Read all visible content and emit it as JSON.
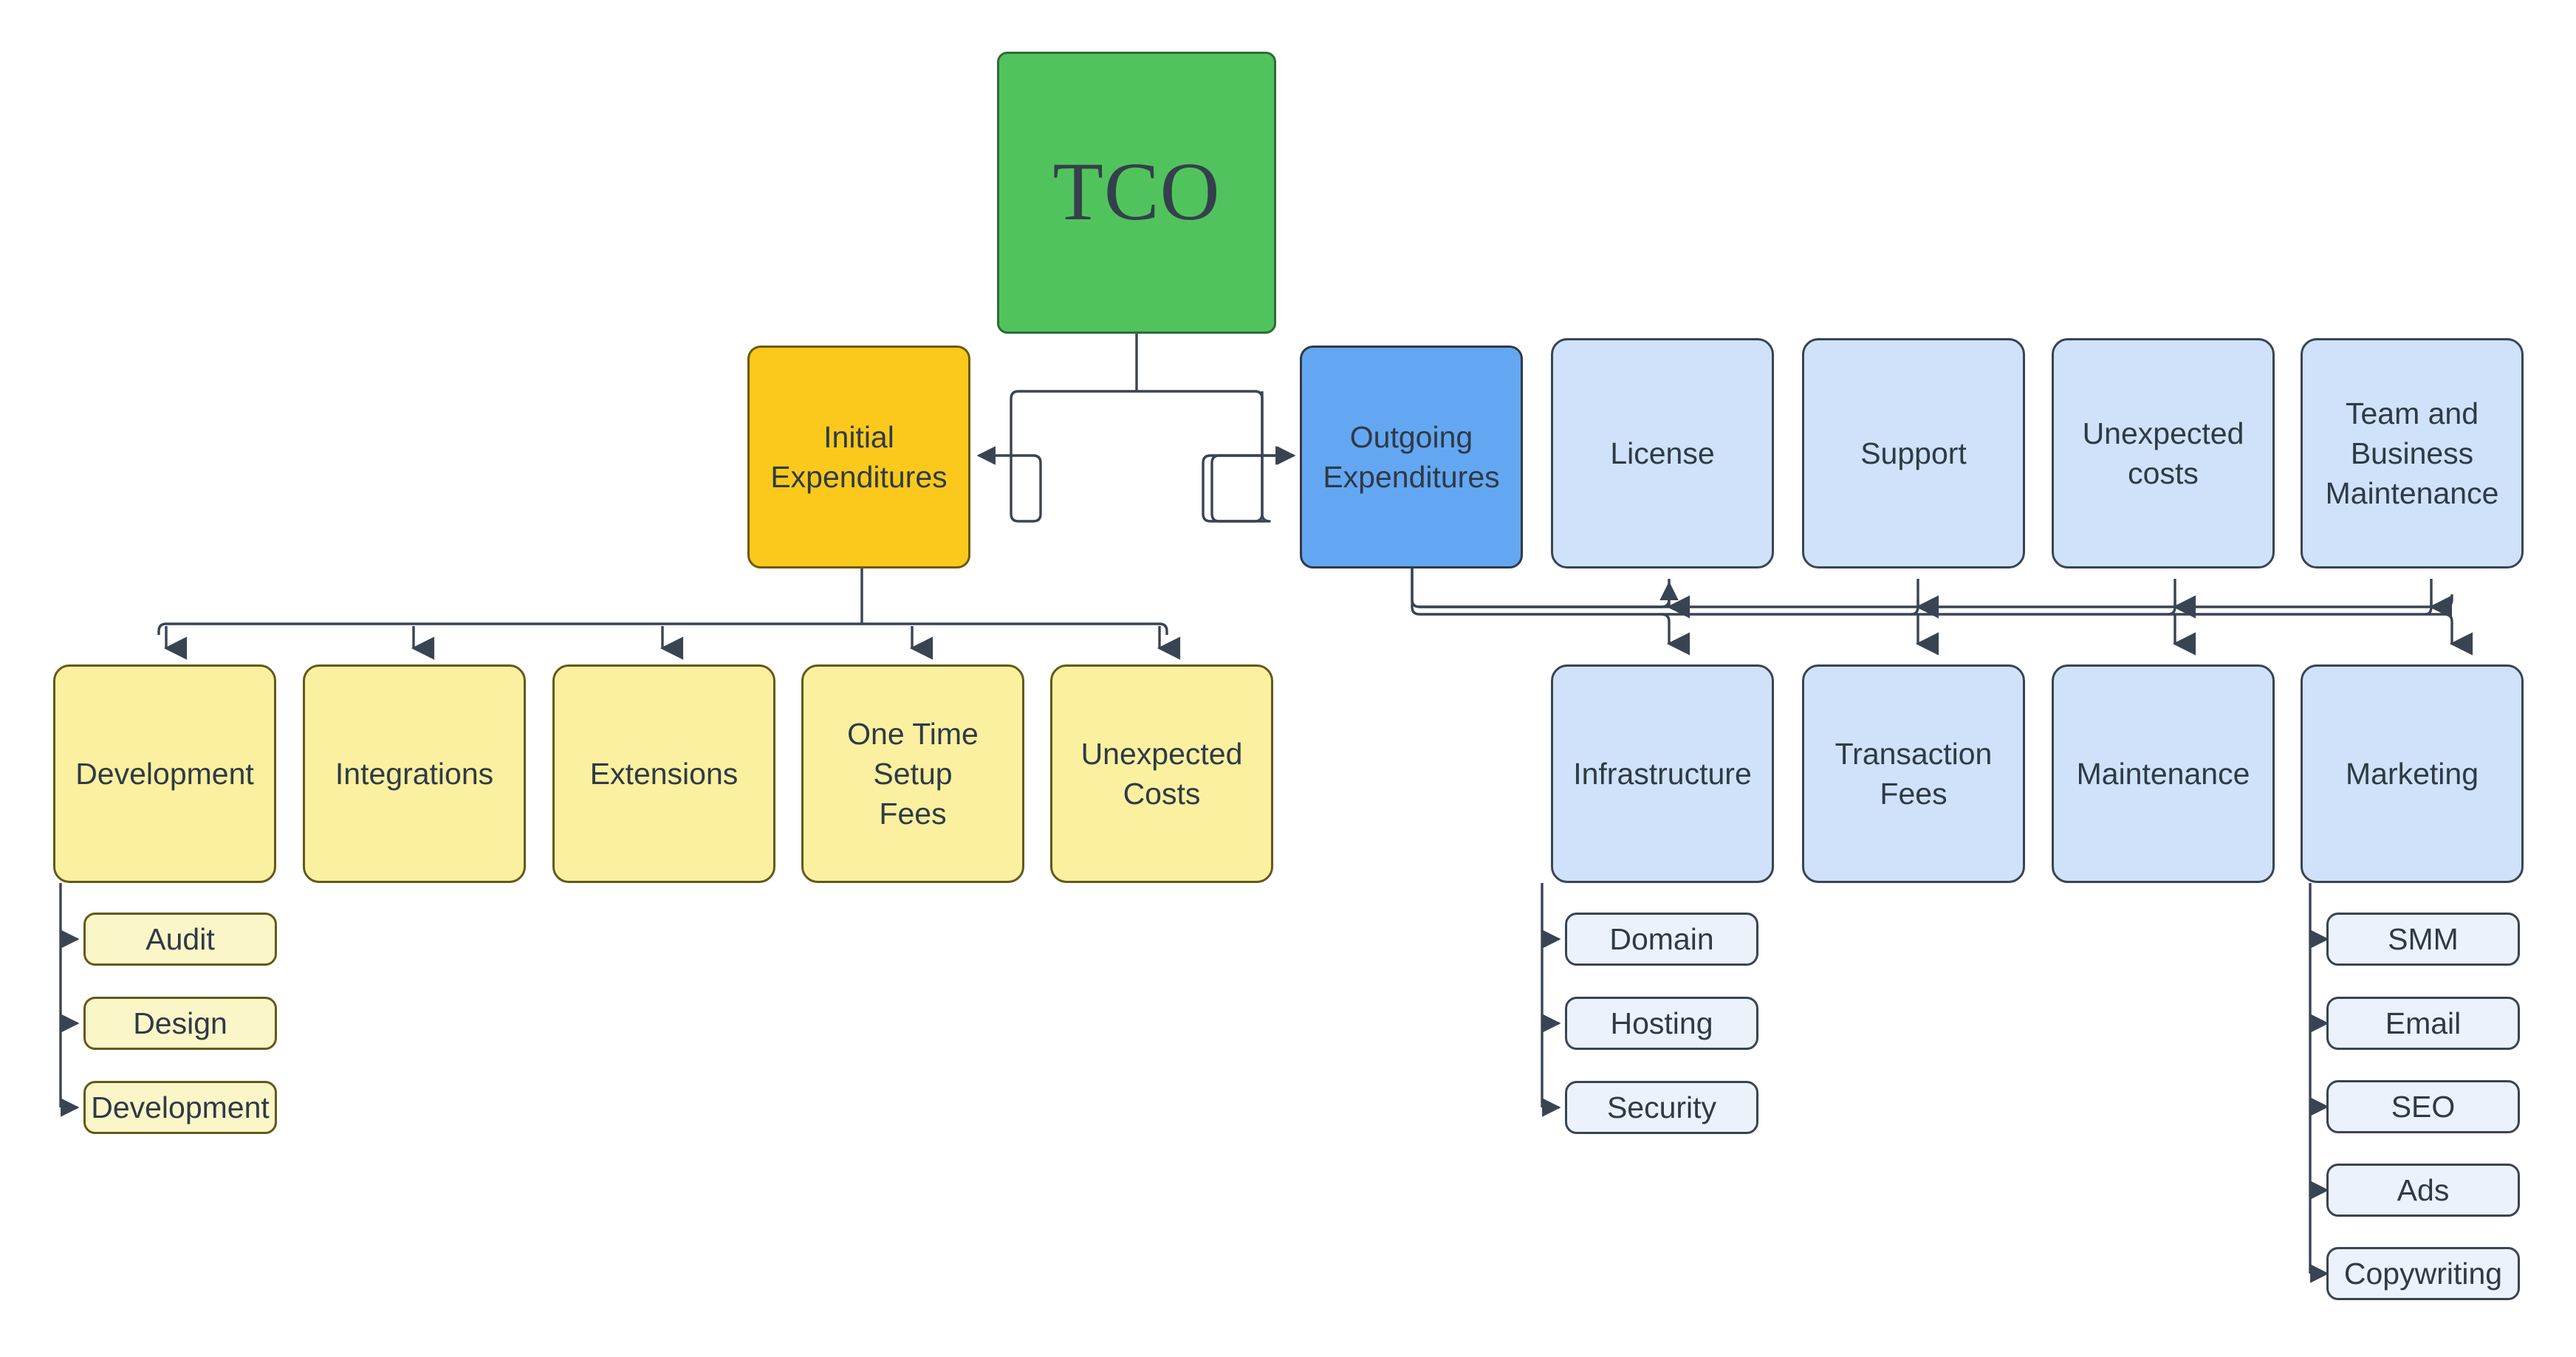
{
  "diagram": {
    "type": "tree",
    "title": "TCO",
    "background_color": "#ffffff",
    "edge_color": "#394453",
    "colors": {
      "root": "#51C35C",
      "branch_initial": "#FBC91B",
      "branch_outgoing": "#63A7F2",
      "category_yellow": "#FAF0A0",
      "category_blue": "#CFE2F9",
      "leaf_yellow": "#FAF6C8",
      "leaf_blue": "#EBF2FB",
      "text": "#2f3a46"
    }
  },
  "nodes": {
    "root": {
      "label": "TCO"
    },
    "initial": {
      "label": "Initial\nExpenditures"
    },
    "outgoing": {
      "label": "Outgoing\nExpenditures"
    },
    "initial_children": [
      {
        "label": "Development"
      },
      {
        "label": "Integrations"
      },
      {
        "label": "Extensions"
      },
      {
        "label": "One Time Setup\nFees"
      },
      {
        "label": "Unexpected\nCosts"
      }
    ],
    "development_children": [
      {
        "label": "Audit"
      },
      {
        "label": "Design"
      },
      {
        "label": "Development"
      }
    ],
    "outgoing_children_upper": [
      {
        "label": "License"
      },
      {
        "label": "Support"
      },
      {
        "label": "Unexpected\ncosts"
      },
      {
        "label": "Team and\nBusiness\nMaintenance"
      }
    ],
    "outgoing_children_lower": [
      {
        "label": "Infrastructure"
      },
      {
        "label": "Transaction\nFees"
      },
      {
        "label": "Maintenance"
      },
      {
        "label": "Marketing"
      }
    ],
    "infrastructure_children": [
      {
        "label": "Domain"
      },
      {
        "label": "Hosting"
      },
      {
        "label": "Security"
      }
    ],
    "marketing_children": [
      {
        "label": "SMM"
      },
      {
        "label": "Email"
      },
      {
        "label": "SEO"
      },
      {
        "label": "Ads"
      },
      {
        "label": "Copywriting"
      }
    ]
  }
}
